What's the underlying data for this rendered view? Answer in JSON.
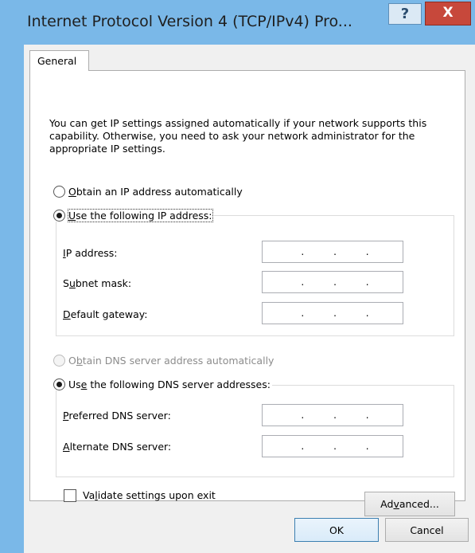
{
  "window": {
    "title": "Internet Protocol Version 4 (TCP/IPv4) Pro...",
    "help_glyph": "?",
    "close_glyph": "X"
  },
  "tabs": [
    {
      "label": "General",
      "selected": true
    }
  ],
  "description": "You can get IP settings assigned automatically if your network supports this capability. Otherwise, you need to ask your network administrator for the appropriate IP settings.",
  "ip_mode": {
    "auto": {
      "pre": "",
      "key": "O",
      "post": "btain an IP address automatically",
      "checked": false
    },
    "manual": {
      "pre": "",
      "key": "U",
      "post": "se the following IP address:",
      "checked": true
    }
  },
  "ip_fields": [
    {
      "pre": "",
      "key": "I",
      "post": "P address:",
      "value": ". . ."
    },
    {
      "pre": "S",
      "key": "u",
      "post": "bnet mask:",
      "value": ". . ."
    },
    {
      "pre": "",
      "key": "D",
      "post": "efault gateway:",
      "value": ". . ."
    }
  ],
  "dns_mode": {
    "auto": {
      "pre": "O",
      "key": "b",
      "post": "tain DNS server address automatically",
      "checked": false,
      "disabled": true
    },
    "manual": {
      "pre": "Us",
      "key": "e",
      "post": " the following DNS server addresses:",
      "checked": true
    }
  },
  "dns_fields": [
    {
      "pre": "",
      "key": "P",
      "post": "referred DNS server:",
      "value": ". . ."
    },
    {
      "pre": "",
      "key": "A",
      "post": "lternate DNS server:",
      "value": ". . ."
    }
  ],
  "validate": {
    "pre": "Va",
    "key": "l",
    "post": "idate settings upon exit",
    "checked": false
  },
  "buttons": {
    "advanced": {
      "pre": "Ad",
      "key": "v",
      "post": "anced..."
    },
    "ok": "OK",
    "cancel": "Cancel"
  },
  "colors": {
    "title_bar": "#7ab8e8",
    "close": "#c7483b",
    "dialog_bg": "#f0f0f0"
  }
}
